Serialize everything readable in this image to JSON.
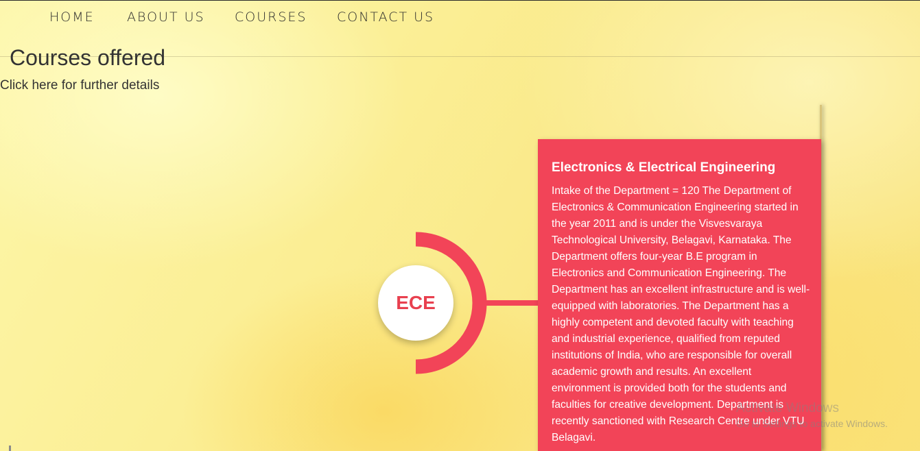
{
  "nav": {
    "items": [
      {
        "label": "HOME"
      },
      {
        "label": "ABOUT US"
      },
      {
        "label": "COURSES"
      },
      {
        "label": "CONTACT US"
      }
    ]
  },
  "main": {
    "title": "Courses offered",
    "subtitle": "Click here for further details"
  },
  "course": {
    "code": "ECE",
    "name": "Electronics & Electrical Engineering",
    "description": "Intake of the Department = 120 The Department of Electronics & Communication Engineering started in the year 2011 and is under the Visvesvaraya Technological University, Belagavi, Karnataka. The Department offers four-year B.E program in Electronics and Communication Engineering. The Department has an excellent infrastructure and is well-equipped with laboratories. The Department has a highly competent and devoted faculty with teaching and industrial experience, qualified from reputed institutions of India, who are responsible for overall academic growth and results. An excellent environment is provided both for the students and faculties for creative development. Department is recently sanctioned with Research Centre under VTU Belagavi."
  },
  "watermark": {
    "title": "Activate Windows",
    "subtitle": "Go to Settings to activate Windows."
  },
  "colors": {
    "accent": "#f24458",
    "code_text": "#e8404f",
    "background": "#fbef96"
  }
}
